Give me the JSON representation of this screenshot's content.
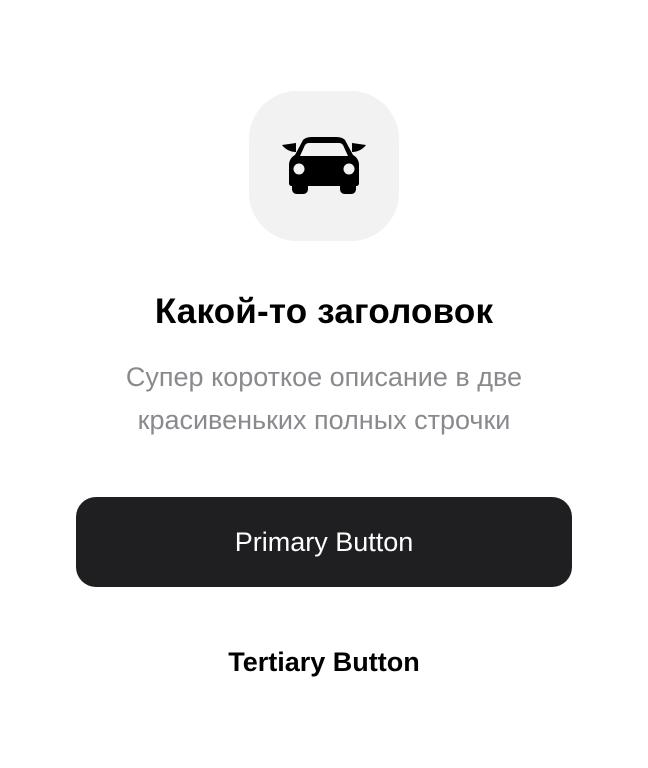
{
  "hero": {
    "icon": "car-icon",
    "tile_color": "#f2f2f3"
  },
  "title": "Какой-то заголовок",
  "description": "Супер короткое описание в две красивеньких полных строчки",
  "primary_button": {
    "label": "Primary Button",
    "background": "#1f1f21",
    "text_color": "#ffffff"
  },
  "tertiary_button": {
    "label": "Tertiary Button",
    "text_color": "#000000"
  }
}
